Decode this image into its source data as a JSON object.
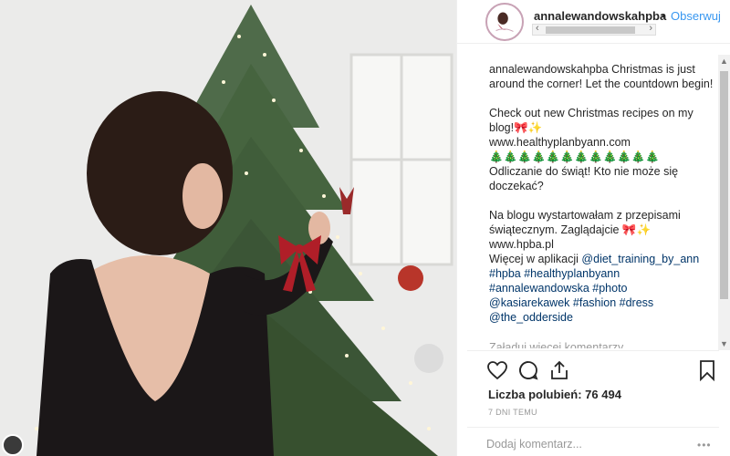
{
  "post": {
    "username": "annalewandowskahpba",
    "separator": "•",
    "follow_label": "Obserwuj",
    "caption_user": "annalewandowskahpba",
    "caption": {
      "line1": "Christmas is just around the corner! Let the countdown begin!",
      "line2": "Check out new Christmas recipes on my blog!🎀✨",
      "line3": "www.healthyplanbyann.com",
      "trees": "🎄🎄🎄🎄🎄🎄🎄🎄🎄🎄🎄🎄",
      "line4": "Odliczanie do świąt! Kto nie może się doczekać?",
      "line5": "Na blogu wystartowałam z przepisami świątecznym. Zaglądajcie 🎀✨",
      "line6": "www.hpba.pl",
      "line7_prefix": "Więcej w aplikacji ",
      "mention1": "@diet_training_by_ann",
      "tags1": "#hpba #healthyplanbyann",
      "tags2": "#annalewandowska #photo",
      "mention2": "@kasiarekawek",
      "tags3": "#fashion #dress",
      "mention3": "@the_odderside"
    },
    "load_more": "Załaduj więcej komentarzy",
    "likes_label": "Liczba polubień: 76 494",
    "time_ago": "7 DNI TEMU",
    "comment_placeholder": "Dodaj komentarz...",
    "more_label": "•••"
  },
  "icons": {
    "like": "heart-icon",
    "comment": "comment-icon",
    "share": "share-icon",
    "save": "bookmark-icon"
  },
  "colors": {
    "link": "#003569",
    "follow": "#3897f0",
    "muted": "#999999",
    "text": "#262626"
  }
}
